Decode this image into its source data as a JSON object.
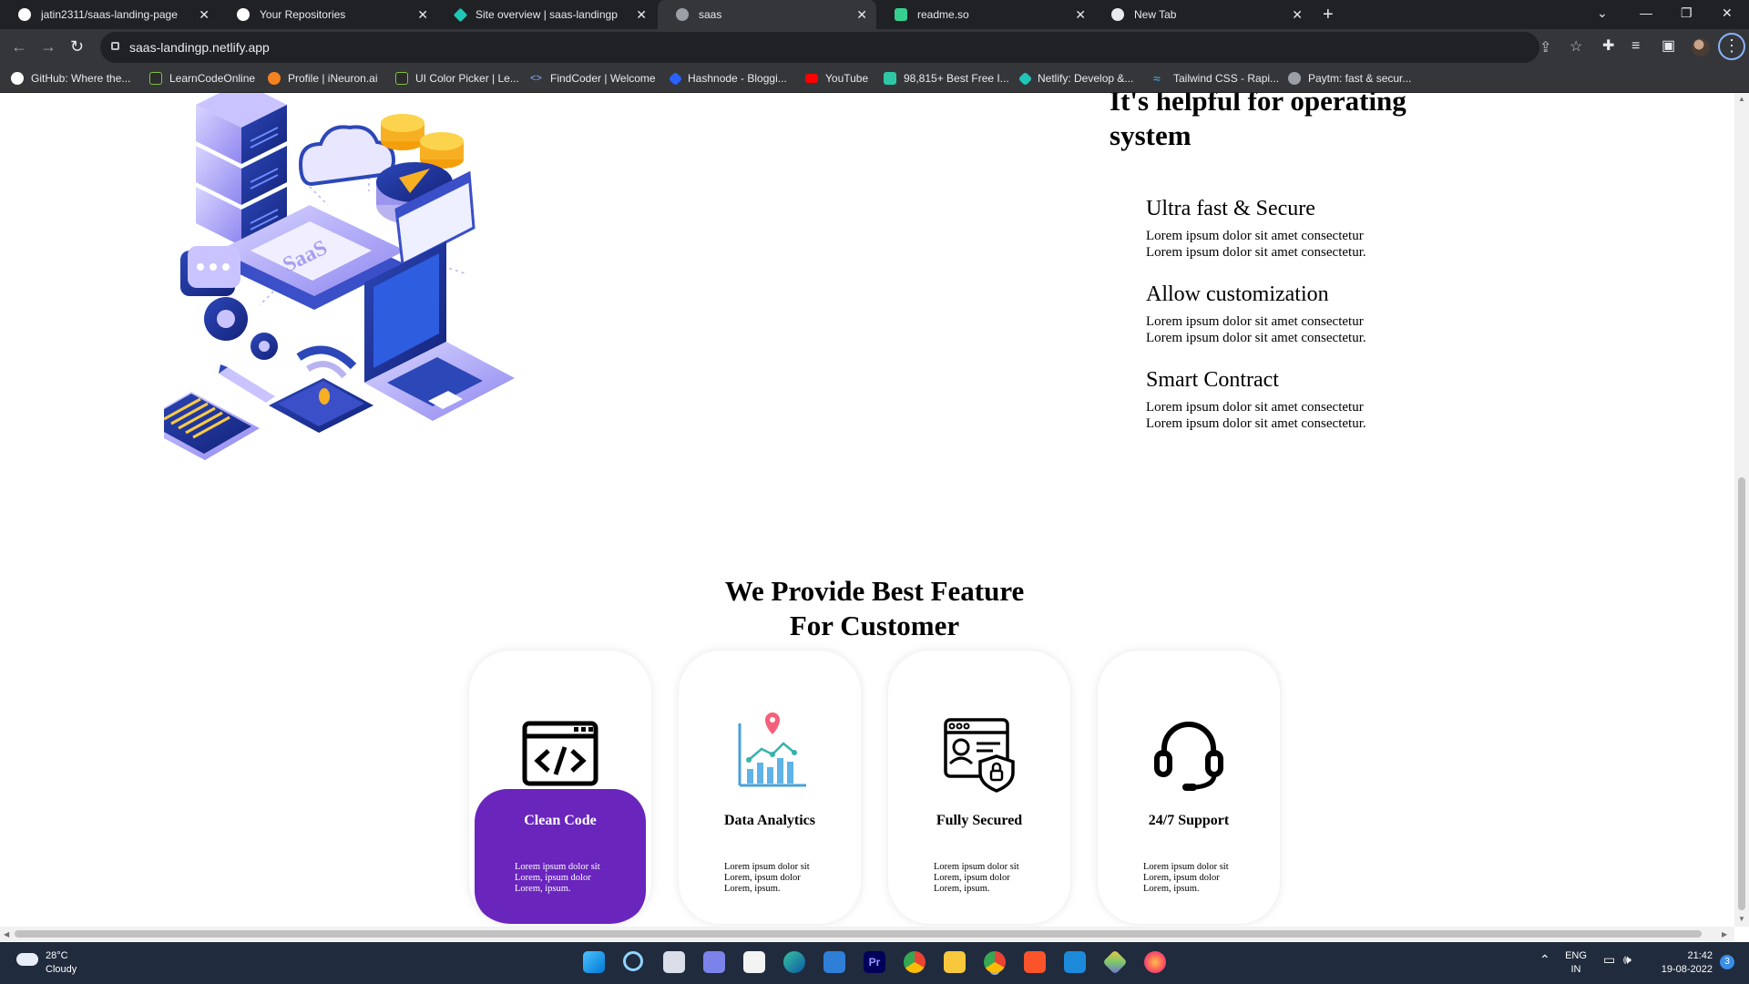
{
  "tabs": [
    {
      "label": "jatin2311/saas-landing-page",
      "icon": "github-icon",
      "active": false
    },
    {
      "label": "Your Repositories",
      "icon": "github-icon",
      "active": false
    },
    {
      "label": "Site overview | saas-landingp",
      "icon": "netlify-icon",
      "active": false
    },
    {
      "label": "saas",
      "icon": "globe-icon",
      "active": true
    },
    {
      "label": "readme.so",
      "icon": "readme-icon",
      "active": false
    },
    {
      "label": "New Tab",
      "icon": "chrome-icon",
      "active": false
    }
  ],
  "address_bar": {
    "url": "saas-landingp.netlify.app"
  },
  "bookmarks": [
    {
      "label": "GitHub: Where the...",
      "icon": "github-icon"
    },
    {
      "label": "LearnCodeOnline",
      "icon": "learncodeonline-icon"
    },
    {
      "label": "Profile | iNeuron.ai",
      "icon": "ineuron-icon"
    },
    {
      "label": "UI Color Picker | Le...",
      "icon": "learncodeonline-icon"
    },
    {
      "label": "FindCoder | Welcome",
      "icon": "code-icon"
    },
    {
      "label": "Hashnode - Bloggi...",
      "icon": "hashnode-icon"
    },
    {
      "label": "YouTube",
      "icon": "youtube-icon"
    },
    {
      "label": "98,815+ Best Free I...",
      "icon": "freepik-icon"
    },
    {
      "label": "Netlify: Develop &...",
      "icon": "netlify-icon"
    },
    {
      "label": "Tailwind CSS - Rapi...",
      "icon": "tailwind-icon"
    },
    {
      "label": "Paytm: fast & secur...",
      "icon": "globe-icon"
    }
  ],
  "page": {
    "illustration_label": "SaaS",
    "helpful_heading": "It's helpful for operating system",
    "features": [
      {
        "title": "Ultra fast & Secure",
        "line1": "Lorem ipsum dolor sit amet consectetur",
        "line2": "Lorem ipsum dolor sit amet consectetur."
      },
      {
        "title": "Allow customization",
        "line1": "Lorem ipsum dolor sit amet consectetur",
        "line2": "Lorem ipsum dolor sit amet consectetur."
      },
      {
        "title": "Smart Contract",
        "line1": "Lorem ipsum dolor sit amet consectetur",
        "line2": "Lorem ipsum dolor sit amet consectetur."
      }
    ],
    "best_feature": {
      "line1": "We Provide Best Feature",
      "line2": "For Customer"
    },
    "cards": [
      {
        "title": "Clean Code",
        "icon": "code-window-icon",
        "lines": [
          "Lorem ipsum dolor sit",
          "Lorem, ipsum dolor",
          "Lorem, ipsum."
        ],
        "active": true
      },
      {
        "title": "Data Analytics",
        "icon": "analytics-chart-icon",
        "lines": [
          "Lorem ipsum dolor sit",
          "Lorem, ipsum dolor",
          "Lorem, ipsum."
        ],
        "active": false
      },
      {
        "title": "Fully Secured",
        "icon": "secure-profile-icon",
        "lines": [
          "Lorem ipsum dolor sit",
          "Lorem, ipsum dolor",
          "Lorem, ipsum."
        ],
        "active": false
      },
      {
        "title": "24/7 Support",
        "icon": "headset-icon",
        "lines": [
          "Lorem ipsum dolor sit",
          "Lorem, ipsum dolor",
          "Lorem, ipsum."
        ],
        "active": false
      }
    ],
    "accent_color": "#6a25bd"
  },
  "taskbar": {
    "weather": {
      "temp": "28°C",
      "condition": "Cloudy"
    },
    "language": {
      "line1": "ENG",
      "line2": "IN"
    },
    "clock": {
      "time": "21:42",
      "date": "19-08-2022"
    },
    "notification_count": "3"
  }
}
